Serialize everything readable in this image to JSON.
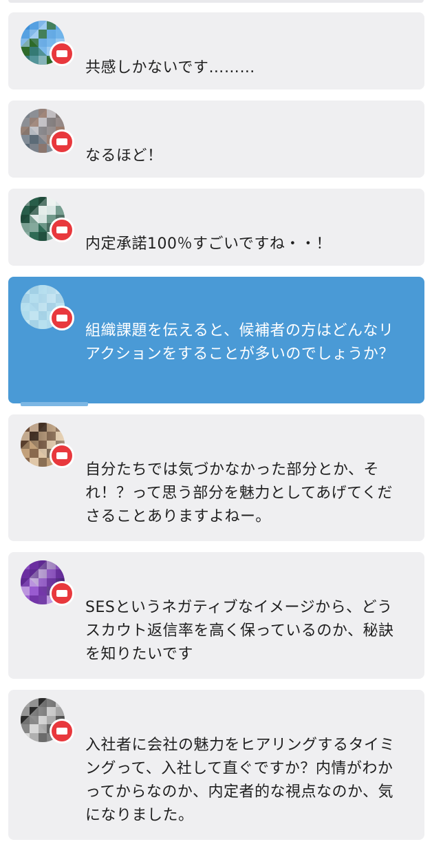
{
  "comments": [
    {
      "text": "共感しかないです………",
      "active": false,
      "avatar_colors": [
        "#3e8fd8",
        "#2e6a2a",
        "#a9d0f2",
        "#6eb3ea"
      ]
    },
    {
      "text": "なるほど！",
      "active": false,
      "avatar_colors": [
        "#8c8f95",
        "#5c6b78",
        "#c7c9cf",
        "#9a7a6a"
      ]
    },
    {
      "text": "内定承諾100％すごいですね・・！",
      "active": false,
      "avatar_colors": [
        "#1f4a3a",
        "#2f6a55",
        "#cfe0dc",
        "#eef3f1"
      ]
    },
    {
      "text": "組織課題を伝えると、候補者の方はどんなリアクションをすることが多いのでしょうか？",
      "active": true,
      "avatar_colors": [
        "#a9d6ea",
        "#b7e0ef",
        "#9fcde3",
        "#c9e7f3"
      ]
    },
    {
      "text": "自分たちでは気づかなかった部分とか、それ！？って思う部分を魅力としてあげてくださることありますよねー。",
      "active": false,
      "avatar_colors": [
        "#6a4a35",
        "#c2a07a",
        "#3a2a20",
        "#e8d2b5"
      ]
    },
    {
      "text": "SESというネガティブなイメージから、どうスカウト返信率を高く保っているのか、秘訣を知りたいです",
      "active": false,
      "avatar_colors": [
        "#6b2fa0",
        "#9a5bd0",
        "#d8c4ea",
        "#4a1f7a"
      ]
    },
    {
      "text": "入社者に会社の魅力をヒアリングするタイミングって、入社して直ぐですか？内情がわかってからなのか、内定者的な視点なのか、気になりました。",
      "active": false,
      "avatar_colors": [
        "#2a2a2a",
        "#b0b0b0",
        "#e5e5e5",
        "#6a6a6a"
      ]
    }
  ]
}
